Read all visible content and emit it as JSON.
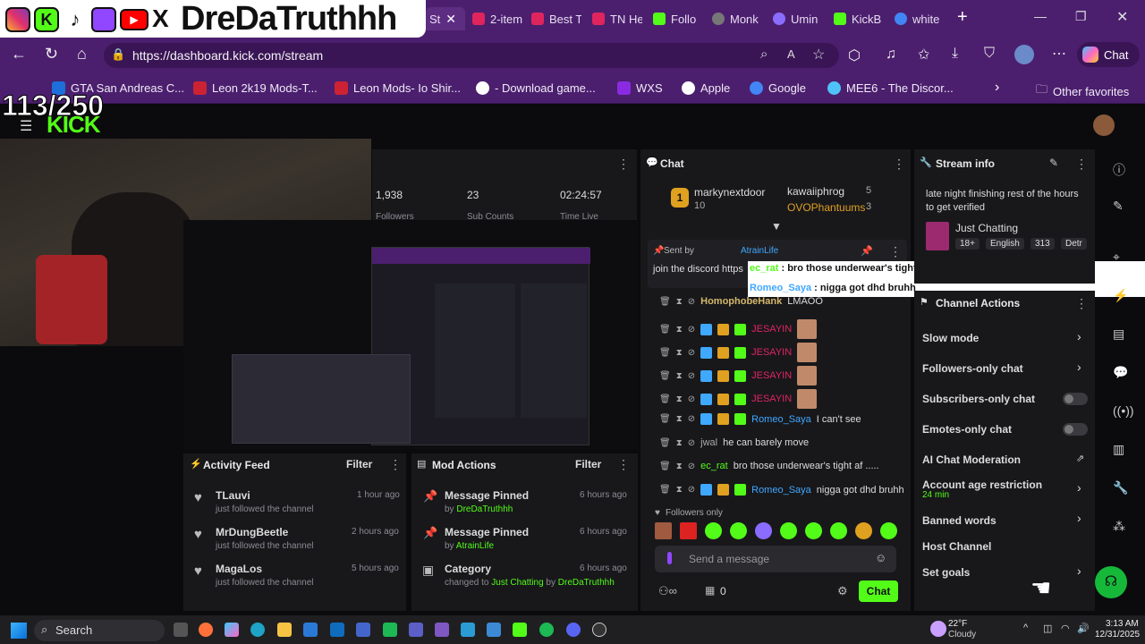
{
  "overlay": {
    "social_handle": "DreDaTruthhh",
    "counter": "113/250"
  },
  "tabs": [
    {
      "label": "St",
      "color": "#53fc18"
    },
    {
      "label": "2-item",
      "color": "#e0245e"
    },
    {
      "label": "Best T",
      "color": "#e0245e"
    },
    {
      "label": "TN He",
      "color": "#e0245e"
    },
    {
      "label": "Follo",
      "color": "#53fc18"
    },
    {
      "label": "Monk",
      "color": "#777777"
    },
    {
      "label": "Umin",
      "color": "#8a6cff"
    },
    {
      "label": "KickB",
      "color": "#53fc18"
    },
    {
      "label": "white",
      "color": "#4285f4"
    }
  ],
  "url": "https://dashboard.kick.com/stream",
  "copilot_label": "Chat",
  "bookmarks": [
    {
      "label": "GTA San Andreas C...",
      "color": "#1e6fd9"
    },
    {
      "label": "Leon 2k19 Mods-T...",
      "color": "#cc2233"
    },
    {
      "label": "Leon Mods- Io Shir...",
      "color": "#cc2233"
    },
    {
      "label": "- Download game...",
      "color": "#ffffff"
    },
    {
      "label": "WXS",
      "color": "#8a2be2"
    },
    {
      "label": "Apple",
      "color": "#ffffff"
    },
    {
      "label": "Google",
      "color": "#4285f4"
    },
    {
      "label": "MEE6 - The Discor...",
      "color": "#4fc3f7"
    }
  ],
  "other_favorites": "Other favorites",
  "stats": {
    "followers": "1,938",
    "followers_label": "Followers",
    "subs": "23",
    "subs_label": "Sub Counts",
    "time_live": "02:24:57",
    "time_live_label": "Time Live"
  },
  "activity": {
    "title": "Activity Feed",
    "filter": "Filter",
    "items": [
      {
        "name": "TLauvi",
        "sub": "just followed the channel",
        "time": "1 hour ago"
      },
      {
        "name": "MrDungBeetle",
        "sub": "just followed the channel",
        "time": "2 hours ago"
      },
      {
        "name": "MagaLos",
        "sub": "just followed the channel",
        "time": "5 hours ago"
      }
    ]
  },
  "mod_actions": {
    "title": "Mod Actions",
    "filter": "Filter",
    "items": [
      {
        "name": "Message Pinned",
        "by": "by ",
        "user": "DreDaTruthhh",
        "time": "6 hours ago"
      },
      {
        "name": "Message Pinned",
        "by": "by ",
        "user": "AtrainLife",
        "time": "6 hours ago"
      },
      {
        "name": "Category",
        "by": "changed to ",
        "user": "Just Chatting",
        "by2": " by ",
        "user2": "DreDaTruthhh",
        "time": "6 hours ago"
      }
    ]
  },
  "chat": {
    "title": "Chat",
    "leaders": [
      {
        "name": "markynextdoor",
        "value": "10",
        "rank": "1"
      },
      {
        "name": "kawaiiphrog",
        "value": "5"
      },
      {
        "name": "OVOPhantuums",
        "value": "3"
      }
    ],
    "pinned": {
      "prefix": "Sent by",
      "user": "AtrainLife",
      "text": "join the discord https"
    },
    "overlay_msgs": [
      {
        "user": "ec_rat",
        "text": "bro those underwear's tight af ....."
      },
      {
        "user": "Romeo_Saya",
        "text": "nigga got dhd bruhh"
      }
    ],
    "messages": [
      {
        "user": "HomophobeHank",
        "text": "LMAOO",
        "color": "#d4b86a"
      },
      {
        "user": "JESAYIN",
        "text": "",
        "color": "#e0245e"
      },
      {
        "user": "JESAYIN",
        "text": "",
        "color": "#e0245e"
      },
      {
        "user": "JESAYIN",
        "text": "",
        "color": "#e0245e"
      },
      {
        "user": "JESAYIN",
        "text": "",
        "color": "#e0245e"
      },
      {
        "user": "Romeo_Saya",
        "text": "I can't see",
        "color": "#3fa8ff"
      },
      {
        "user": "jwal",
        "text": "he can barely move",
        "color": "#aaaaaa"
      },
      {
        "user": "ec_rat",
        "text": "bro those underwear's tight af .....",
        "color": "#53fc18"
      },
      {
        "user": "Romeo_Saya",
        "text": "nigga got dhd bruhh",
        "color": "#3fa8ff"
      }
    ],
    "followers_only": "Followers only",
    "placeholder": "Send a message",
    "viewer_count": "0",
    "send": "Chat"
  },
  "stream_info": {
    "title": "Stream info",
    "stream_title": "late night finishing rest of the hours to get verified",
    "category": "Just Chatting",
    "tags": [
      "18+",
      "English",
      "313",
      "Detr"
    ]
  },
  "channel_actions": {
    "title": "Channel Actions",
    "items": [
      "Slow mode",
      "Followers-only chat",
      "Subscribers-only chat",
      "Emotes-only chat",
      "AI Chat Moderation",
      "Account age restriction",
      "Banned words",
      "Host Channel",
      "Set goals"
    ],
    "age_sub": "24 min"
  },
  "taskbar": {
    "search": "Search",
    "weather_temp": "22°F",
    "weather_desc": "Cloudy",
    "time": "3:13 AM",
    "date": "12/31/2025"
  }
}
